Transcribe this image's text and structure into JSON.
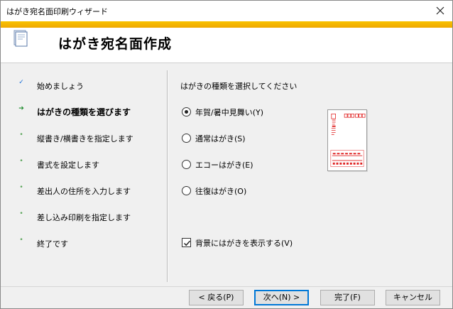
{
  "window": {
    "title": "はがき宛名面印刷ウィザード",
    "heading": "はがき宛名面作成"
  },
  "steps": [
    {
      "label": "始めましょう",
      "bullet": "✓",
      "state": "done"
    },
    {
      "label": "はがきの種類を選びます",
      "bullet": "➔",
      "state": "current"
    },
    {
      "label": "縦書き/横書きを指定します",
      "bullet": "•",
      "state": "todo"
    },
    {
      "label": "書式を設定します",
      "bullet": "•",
      "state": "todo"
    },
    {
      "label": "差出人の住所を入力します",
      "bullet": "•",
      "state": "todo"
    },
    {
      "label": "差し込み印刷を指定します",
      "bullet": "•",
      "state": "todo"
    },
    {
      "label": "終了です",
      "bullet": "•",
      "state": "todo"
    }
  ],
  "panel": {
    "prompt": "はがきの種類を選択してください",
    "options": [
      {
        "label": "年賀/暑中見舞い(Y)",
        "checked": true
      },
      {
        "label": "通常はがき(S)",
        "checked": false
      },
      {
        "label": "エコーはがき(E)",
        "checked": false
      },
      {
        "label": "往復はがき(O)",
        "checked": false
      }
    ],
    "show_background": {
      "label": "背景にはがきを表示する(V)",
      "checked": true
    }
  },
  "buttons": {
    "back": "< 戻る(P)",
    "next": "次へ(N) >",
    "finish": "完了(F)",
    "cancel": "キャンセル"
  },
  "colors": {
    "banner": "#f0a800",
    "postcard_red": "#e02020",
    "focus_blue": "#0078d7"
  }
}
